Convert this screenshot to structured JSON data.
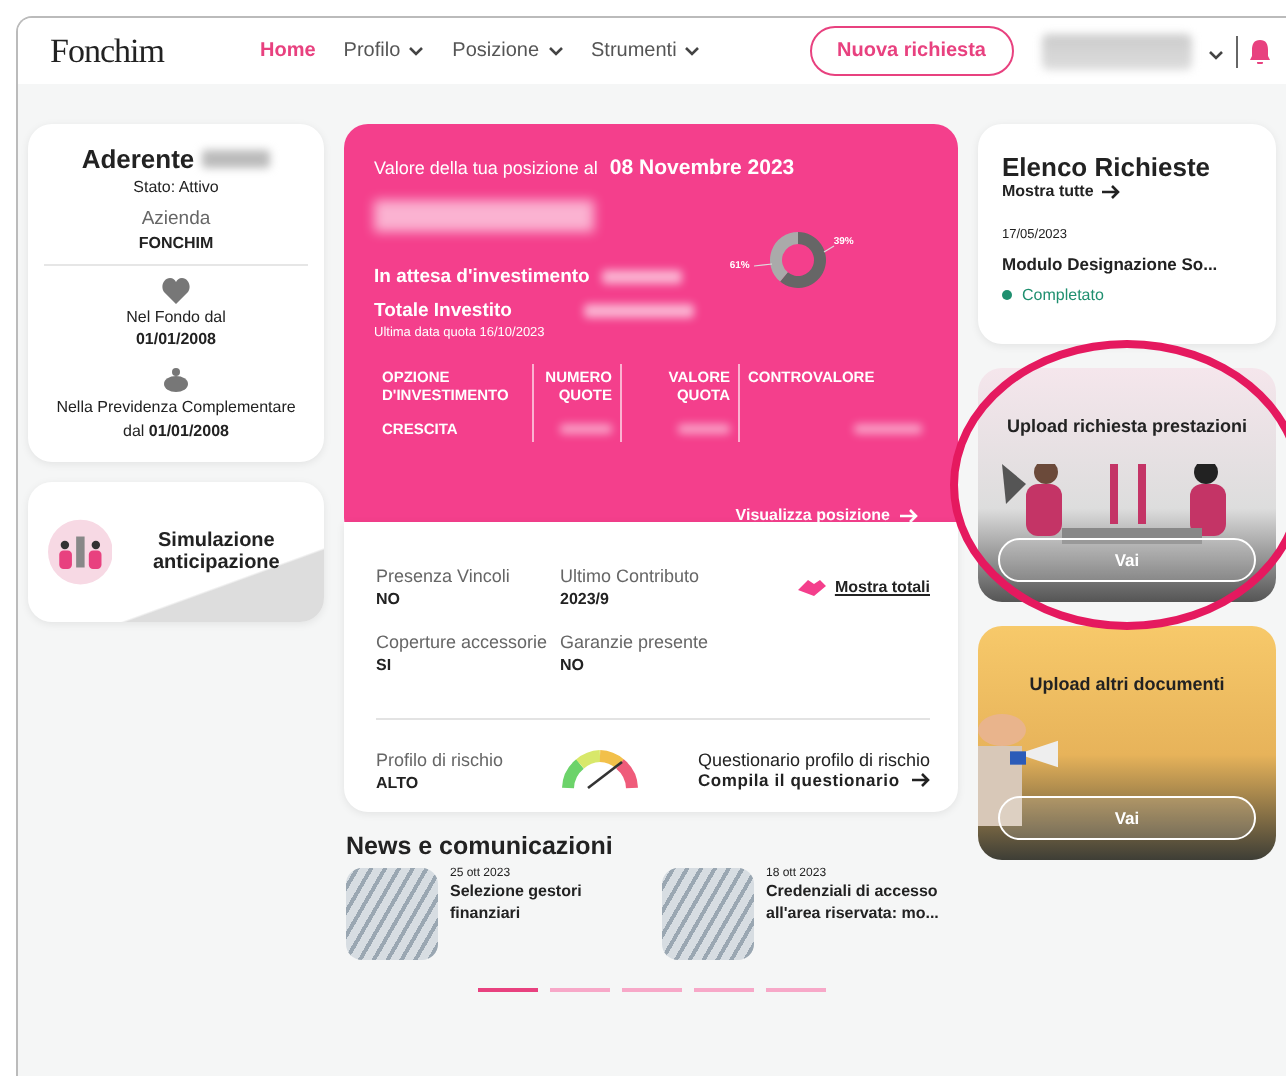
{
  "header": {
    "logo": "Fonchim",
    "nav": [
      {
        "label": "Home",
        "selected": true,
        "dropdown": false
      },
      {
        "label": "Profilo",
        "selected": false,
        "dropdown": true
      },
      {
        "label": "Posizione",
        "selected": false,
        "dropdown": true
      },
      {
        "label": "Strumenti",
        "selected": false,
        "dropdown": true
      }
    ],
    "new_request_button": "Nuova richiesta"
  },
  "member_card": {
    "title": "Aderente",
    "status": "Stato: Attivo",
    "company_label": "Azienda",
    "company": "FONCHIM",
    "fund_since_label": "Nel Fondo dal",
    "fund_since": "01/01/2008",
    "pension_since": "Nella Previdenza Complementare dal **01/01/2008**"
  },
  "simulation_card": {
    "title": "Simulazione anticipazione"
  },
  "position_card": {
    "title": "Valore della tua posizione al",
    "date": "08 Novembre 2023",
    "pending_label": "In attesa d'investimento",
    "invested_label": "Totale Investito",
    "last_quote": "Ultima data quota 16/10/2023",
    "chart_data": {
      "type": "donut",
      "values": [
        61,
        39
      ],
      "value_labels": [
        "61%",
        "39%"
      ]
    },
    "table": {
      "columns": [
        "OPZIONE D'INVESTIMENTO",
        "NUMERO QUOTE",
        "VALORE QUOTA",
        "CONTROVALORE"
      ],
      "rows": [
        {
          "option": "CRESCITA"
        }
      ]
    },
    "link": "Visualizza posizione"
  },
  "details": {
    "fields": [
      {
        "label": "Presenza Vincoli",
        "value": "NO"
      },
      {
        "label": "Ultimo Contributo",
        "value": "2023/9"
      },
      {
        "label": "Coperture accessorie",
        "value": "SI"
      },
      {
        "label": "Garanzie presente",
        "value": "NO"
      }
    ],
    "show_totals": "Mostra totali",
    "risk_label": "Profilo di rischio",
    "risk_value": "ALTO",
    "questionnaire_label": "Questionario profilo di rischio",
    "questionnaire_link": "Compila il questionario"
  },
  "news": {
    "title": "News e comunicazioni",
    "items": [
      {
        "date": "25 ott 2023",
        "title": "Selezione gestori finanziari"
      },
      {
        "date": "18 ott 2023",
        "title": "Credenziali di accesso all'area riservata: mo..."
      }
    ],
    "pager": [
      {
        "selected": true
      },
      {
        "selected": false
      },
      {
        "selected": false
      },
      {
        "selected": false
      },
      {
        "selected": false
      }
    ]
  },
  "requests": {
    "title": "Elenco Richieste",
    "show_all": "Mostra tutte",
    "items": [
      {
        "date": "17/05/2023",
        "title": "Modulo Designazione So...",
        "status": "Completato",
        "color": "#1f8f6f"
      }
    ]
  },
  "upload_cards": [
    {
      "kind": "meeting",
      "title": "Upload richiesta prestazioni",
      "button": "Vai",
      "highlighted": true
    },
    {
      "kind": "megaphone",
      "title": "Upload altri documenti",
      "button": "Vai",
      "highlighted": false
    }
  ]
}
